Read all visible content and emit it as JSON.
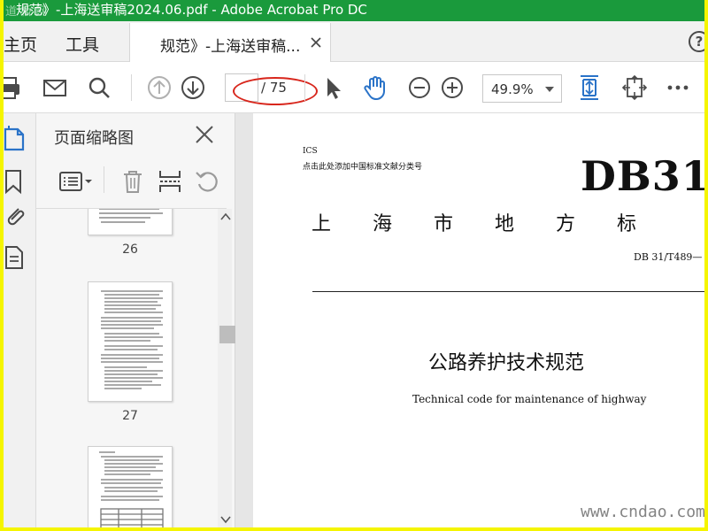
{
  "titlebar": {
    "title": "规范》-上海送审稿2024.06.pdf - Adobe Acrobat Pro DC",
    "watermark": "道 桥 网"
  },
  "menu": {
    "home": "主页",
    "tools": "工具"
  },
  "doc_tab": {
    "label": "规范》-上海送审稿..."
  },
  "help": {
    "label": "?"
  },
  "toolbar": {
    "page_current": "",
    "page_total": "/ 75",
    "zoom": "49.9%"
  },
  "thumbnails": {
    "title": "页面缩略图",
    "pages": [
      {
        "label": "26"
      },
      {
        "label": "27"
      },
      {
        "label": ""
      }
    ]
  },
  "document": {
    "ics": "ICS",
    "classify": "点击此处添加中国标准文献分类号",
    "big_code": "DB31",
    "standard_name": "上海市地方标",
    "standard_no": "DB 31/T489—",
    "title": "公路养护技术规范",
    "subtitle": "Technical code for maintenance of highway"
  },
  "watermark_bottom": "www.cndao.com",
  "colors": {
    "titlebar": "#1a9a3c",
    "accent_blue": "#2a73c8",
    "highlight_red": "#d8261c",
    "frame": "#f5f500"
  }
}
